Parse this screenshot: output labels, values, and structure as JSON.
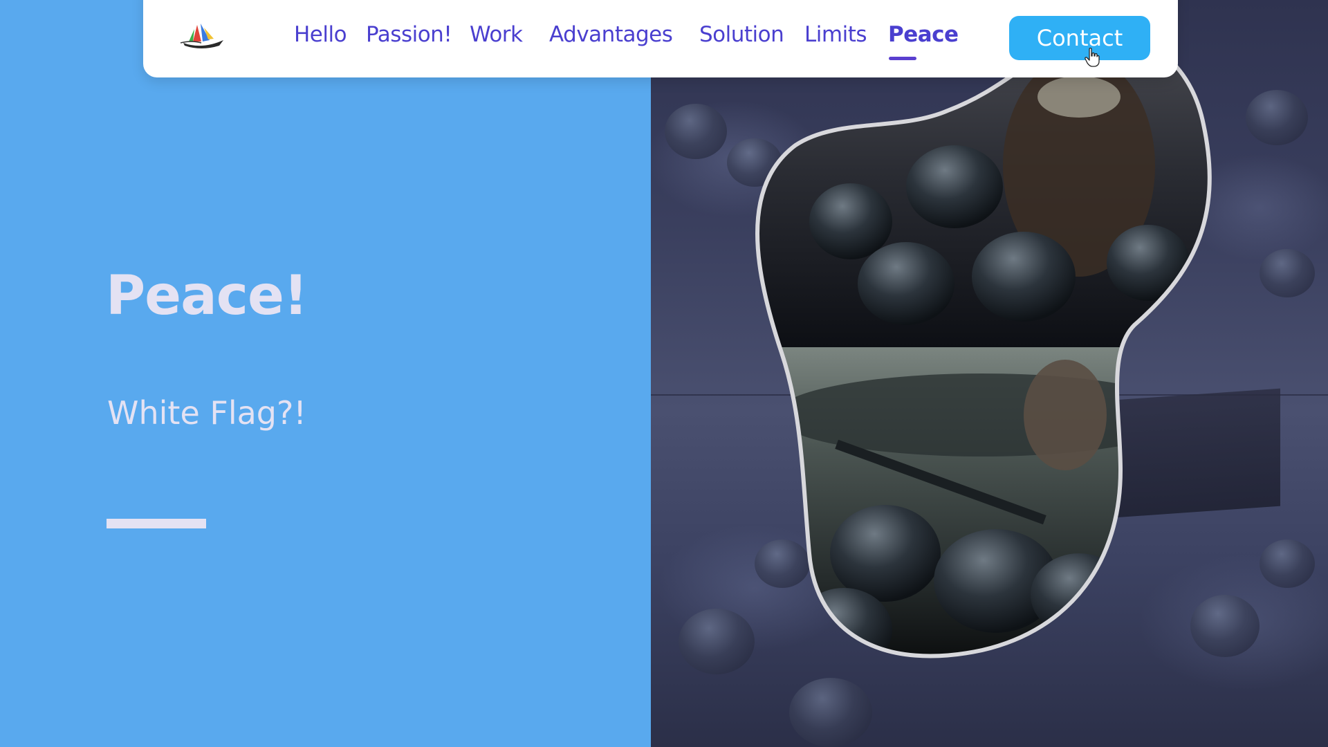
{
  "nav": {
    "logo": "ship-logo",
    "links": [
      {
        "label": "Hello"
      },
      {
        "label": "Passion!"
      },
      {
        "label": "Work"
      },
      {
        "label": "Advantages"
      },
      {
        "label": "Solution"
      },
      {
        "label": "Limits"
      },
      {
        "label": "Peace",
        "active": true
      }
    ],
    "contact_label": "Contact"
  },
  "hero": {
    "title": "Peace!",
    "subtitle": "White Flag?!"
  },
  "colors": {
    "background": "#59a9ee",
    "nav_text": "#4a3fcf",
    "contact_button": "#2fb0f5",
    "hero_text": "#e4e2f3"
  },
  "images": {
    "background_image": "viking-battle-collage",
    "framed_image": "viking-warriors-blob"
  },
  "icons": {
    "cursor": "hand-pointer-icon"
  }
}
